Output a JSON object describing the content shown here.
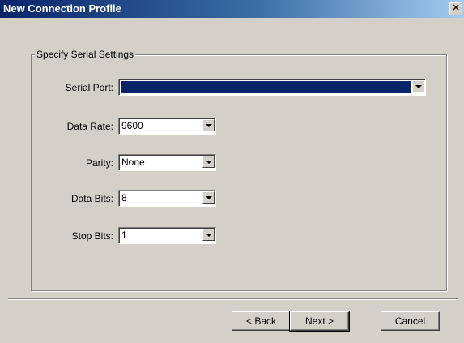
{
  "window": {
    "title": "New Connection Profile",
    "close_glyph": "✕"
  },
  "group": {
    "legend": "Specify Serial Settings"
  },
  "fields": {
    "serial_port": {
      "label": "Serial Port:",
      "value": ""
    },
    "data_rate": {
      "label": "Data Rate:",
      "value": "9600"
    },
    "parity": {
      "label": "Parity:",
      "value": "None"
    },
    "data_bits": {
      "label": "Data Bits:",
      "value": "8"
    },
    "stop_bits": {
      "label": "Stop Bits:",
      "value": "1"
    }
  },
  "buttons": {
    "back": "< Back",
    "next": "Next >",
    "cancel": "Cancel"
  },
  "colors": {
    "dialog_bg": "#d4d0c8",
    "titlebar_start": "#0a246a",
    "selection": "#0a246a"
  },
  "icons": {
    "dropdown": "chevron-down-icon",
    "close": "close-icon"
  }
}
